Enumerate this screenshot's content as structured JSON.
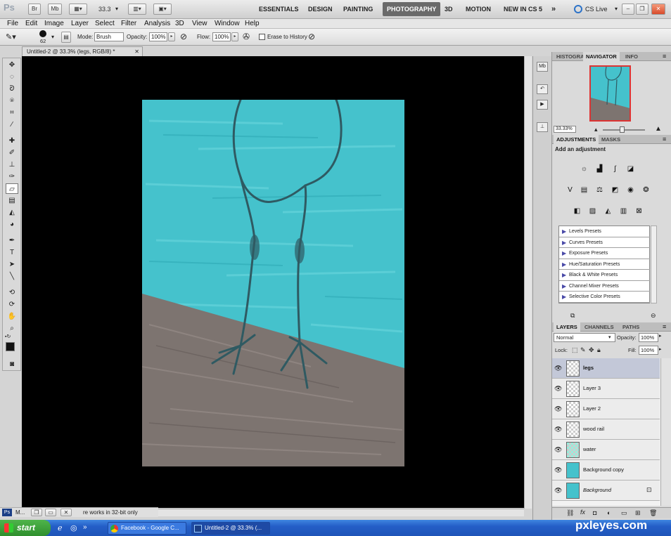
{
  "app": {
    "logo": "Ps"
  },
  "topbar": {
    "icons": [
      "Br",
      "Mb"
    ],
    "zoom": "33.3",
    "workspaces": [
      "ESSENTIALS",
      "DESIGN",
      "PAINTING",
      "PHOTOGRAPHY",
      "3D",
      "MOTION",
      "NEW IN CS 5"
    ],
    "active_workspace": "PHOTOGRAPHY",
    "more": "»",
    "cs_live": "CS Live"
  },
  "menu": [
    "File",
    "Edit",
    "Image",
    "Layer",
    "Select",
    "Filter",
    "Analysis",
    "3D",
    "View",
    "Window",
    "Help"
  ],
  "options": {
    "brush_size": "62",
    "mode_label": "Mode:",
    "mode_value": "Brush",
    "opacity_label": "Opacity:",
    "opacity_value": "100%",
    "flow_label": "Flow:",
    "flow_value": "100%",
    "erase_history": "Erase to History"
  },
  "document": {
    "tab_title": "Untitled-2 @ 33.3% (legs, RGB/8) *"
  },
  "status": {
    "ps_icon": "Ps",
    "min_label": "M...",
    "text": "re works in 32-bit only"
  },
  "navigator": {
    "tabs": [
      "HISTOGRAM",
      "NAVIGATOR",
      "INFO"
    ],
    "active": "NAVIGATOR",
    "zoom": "33.33%"
  },
  "adjustments": {
    "tabs": [
      "ADJUSTMENTS",
      "MASKS"
    ],
    "active": "ADJUSTMENTS",
    "heading": "Add an adjustment",
    "presets": [
      "Levels Presets",
      "Curves Presets",
      "Exposure Presets",
      "Hue/Saturation Presets",
      "Black & White Presets",
      "Channel Mixer Presets",
      "Selective Color Presets"
    ]
  },
  "layers": {
    "tabs": [
      "LAYERS",
      "CHANNELS",
      "PATHS"
    ],
    "active": "LAYERS",
    "blend_mode": "Normal",
    "opacity_label": "Opacity:",
    "opacity_value": "100%",
    "lock_label": "Lock:",
    "fill_label": "Fill:",
    "fill_value": "100%",
    "items": [
      {
        "name": "legs",
        "selected": true
      },
      {
        "name": "Layer 3"
      },
      {
        "name": "Layer 2"
      },
      {
        "name": "wood rail"
      },
      {
        "name": "water"
      },
      {
        "name": "Background copy"
      },
      {
        "name": "Background",
        "locked": true
      }
    ]
  },
  "taskbar": {
    "start": "start",
    "tasks": [
      "Facebook - Google C...",
      "Untitled-2 @ 33.3% (..."
    ]
  },
  "watermark": "pxleyes.com",
  "colors": {
    "water": "#45c2cc",
    "wood": "#7d7470",
    "accent_active": "#6a6a6a"
  }
}
